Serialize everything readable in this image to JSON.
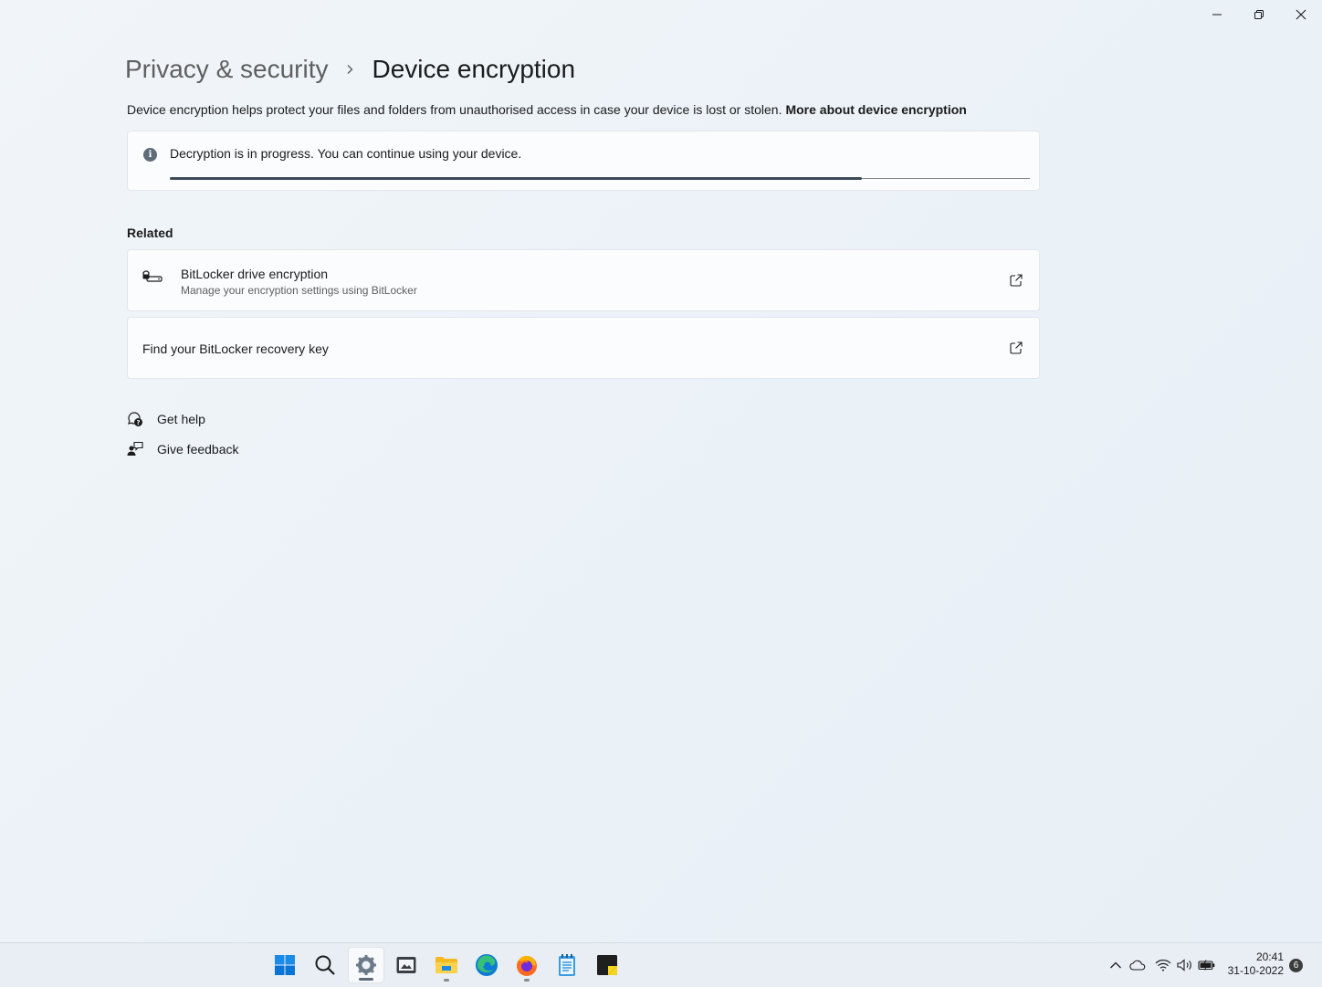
{
  "window": {
    "controls": {
      "minimize": "minimize-icon",
      "maximize": "restore-icon",
      "close": "close-icon"
    }
  },
  "breadcrumb": {
    "parent": "Privacy & security",
    "separator_icon": "chevron-right-icon",
    "current": "Device encryption"
  },
  "description": {
    "text": "Device encryption helps protect your files and folders from unauthorised access in case your device is lost or stolen.",
    "link": "More about device encryption"
  },
  "status": {
    "icon": "info-icon",
    "icon_glyph": "i",
    "message": "Decryption is in progress. You can continue using your device.",
    "progress_fraction": 0.805
  },
  "related": {
    "title": "Related",
    "items": [
      {
        "icon": "bitlocker-drive-icon",
        "title": "BitLocker drive encryption",
        "subtitle": "Manage your encryption settings using BitLocker",
        "action_icon": "open-external-icon"
      },
      {
        "title": "Find your BitLocker recovery key",
        "action_icon": "open-external-icon"
      }
    ]
  },
  "help": {
    "get_help": "Get help",
    "give_feedback": "Give feedback"
  },
  "taskbar": {
    "apps": [
      "start-icon",
      "search-icon",
      "settings-icon",
      "snipping-tool-icon",
      "file-explorer-icon",
      "edge-icon",
      "firefox-icon",
      "notepad-icon",
      "sticky-notes-icon"
    ],
    "tray": [
      "chevron-up-icon",
      "onedrive-icon",
      "wifi-icon",
      "volume-icon",
      "battery-icon"
    ],
    "time": "20:41",
    "date": "31-10-2022",
    "notifications": "6"
  },
  "colors": {
    "background": "#eef3f8",
    "card": "#fbfcfd",
    "progress_fill": "#3c4a5a",
    "accent_blue": "#0a74d6"
  }
}
